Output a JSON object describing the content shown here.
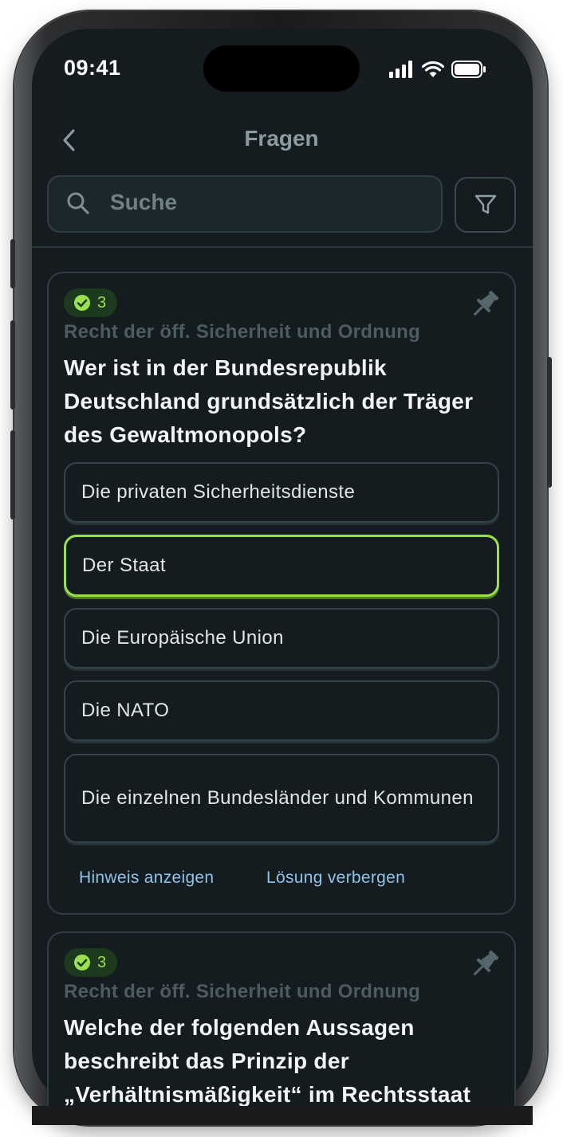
{
  "status_bar": {
    "time": "09:41"
  },
  "nav": {
    "title": "Fragen",
    "back_icon": "chevron-left-icon"
  },
  "search": {
    "placeholder": "Suche",
    "filter_icon": "filter-icon"
  },
  "questions": [
    {
      "badge_count": "3",
      "category": "Recht der öff. Sicherheit und Ordnung",
      "question": "Wer ist in der Bundesrepublik Deutschland grundsätzlich der Träger des Gewaltmonopols?",
      "answers": [
        "Die privaten Sicherheitsdienste",
        "Der Staat",
        "Die Europäische Union",
        "Die NATO",
        "Die einzelnen Bundesländer und Kommunen"
      ],
      "selected_answer_index": 1,
      "hint_label": "Hinweis anzeigen",
      "solution_label": "Lösung verbergen"
    },
    {
      "badge_count": "3",
      "category": "Recht der öff. Sicherheit und Ordnung",
      "question": "Welche der folgenden Aussagen beschreibt das Prinzip der „Verhältnismäßigkeit“ im Rechtsstaat"
    }
  ],
  "colors": {
    "background": "#141c1f",
    "accent_green": "#9be04e",
    "link_blue": "#8fc3e9"
  }
}
